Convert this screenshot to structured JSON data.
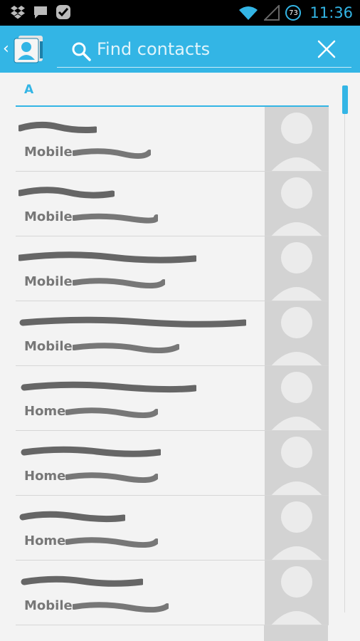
{
  "status_bar": {
    "time": "11:36",
    "battery_level": "73",
    "notification_icons": [
      "dropbox-icon",
      "chat-icon",
      "check-icon"
    ],
    "status_icons": [
      "wifi-icon",
      "signal-icon",
      "battery-icon"
    ]
  },
  "action_bar": {
    "app_icon": "contacts-icon",
    "search_placeholder": "Find contacts",
    "clear_icon": "close-icon"
  },
  "list": {
    "section_letter": "A",
    "contacts": [
      {
        "phone_type": "Mobile"
      },
      {
        "phone_type": "Mobile"
      },
      {
        "phone_type": "Mobile"
      },
      {
        "phone_type": "Mobile"
      },
      {
        "phone_type": "Home"
      },
      {
        "phone_type": "Home"
      },
      {
        "phone_type": "Home"
      },
      {
        "phone_type": "Mobile"
      }
    ]
  },
  "colors": {
    "accent": "#33b5e5",
    "background": "#f3f3f3",
    "photo_placeholder": "#d3d3d3",
    "label_text": "#777777"
  }
}
